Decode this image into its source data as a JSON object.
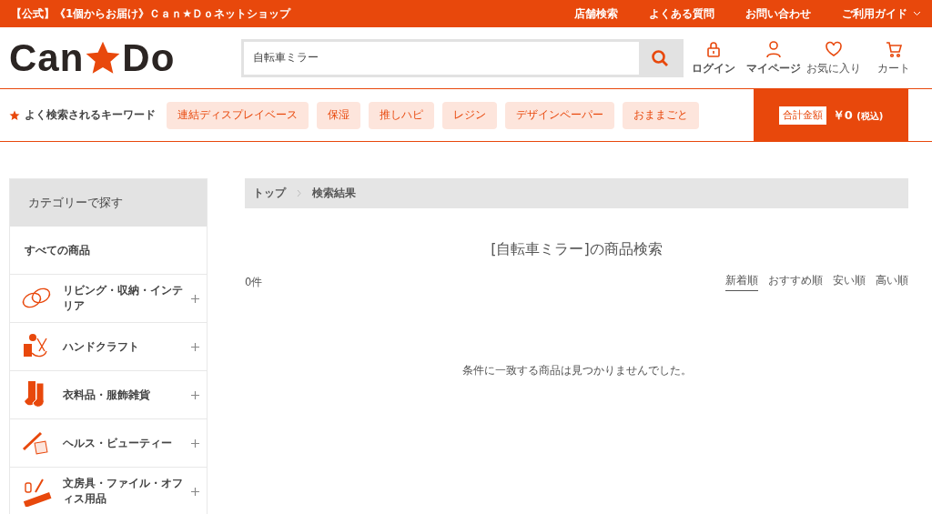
{
  "top_bar": {
    "title": "【公式】《1個からお届け》Ｃａｎ★Ｄｏネットショップ",
    "links": [
      "店舗検索",
      "よくある質問",
      "お問い合わせ",
      "ご利用ガイド"
    ]
  },
  "header": {
    "logo_left": "Can",
    "logo_right": "Do",
    "search": {
      "value": "自転車ミラー"
    },
    "actions": [
      "ログイン",
      "マイページ",
      "お気に入り",
      "カート"
    ]
  },
  "keywords": {
    "label": "よく検索されるキーワード",
    "items": [
      "連結ディスプレイベース",
      "保湿",
      "推しハピ",
      "レジン",
      "デザインペーパー",
      "おままごと"
    ]
  },
  "total": {
    "label": "合計金額",
    "amount": "￥0",
    "tax": "(税込)"
  },
  "sidebar": {
    "title": "カテゴリーで探す",
    "all": "すべての商品",
    "categories": [
      {
        "label": "リビング・収納・インテリア",
        "expanded": false
      },
      {
        "label": "ハンドクラフト",
        "expanded": false
      },
      {
        "label": "衣料品・服飾雑貨",
        "expanded": false
      },
      {
        "label": "ヘルス・ビューティー",
        "expanded": false
      },
      {
        "label": "文房具・ファイル・オフィス用品",
        "expanded": false
      }
    ]
  },
  "breadcrumb": [
    "トップ",
    "検索結果"
  ],
  "heading": "[自転車ミラー]の商品検索",
  "count": "0件",
  "sort": [
    {
      "label": "新着順",
      "selected": true
    },
    {
      "label": "おすすめ順",
      "selected": false
    },
    {
      "label": "安い順",
      "selected": false
    },
    {
      "label": "高い順",
      "selected": false
    }
  ],
  "empty_message": "条件に一致する商品は見つかりませんでした。"
}
